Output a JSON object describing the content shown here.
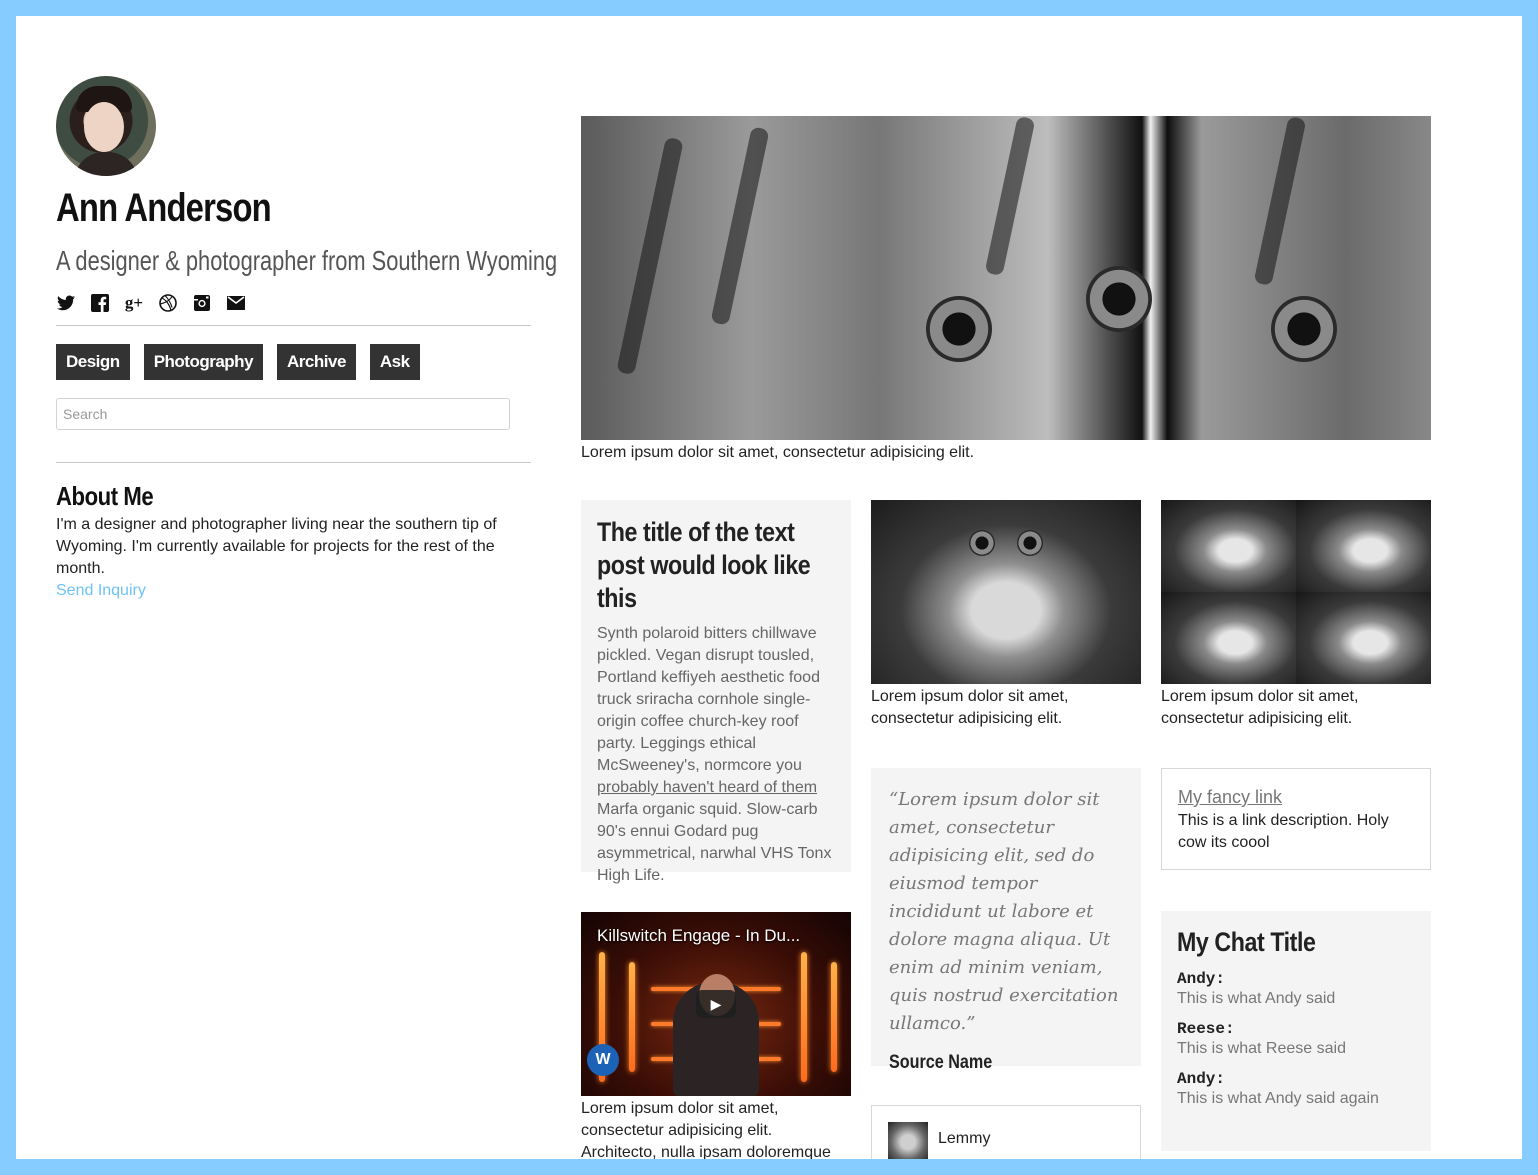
{
  "profile": {
    "name": "Ann Anderson",
    "tagline": "A designer & photographer from Southern Wyoming"
  },
  "socials": [
    {
      "icon": "twitter-icon",
      "glyph": "🐦"
    },
    {
      "icon": "facebook-icon",
      "glyph": "f"
    },
    {
      "icon": "google-plus-icon",
      "glyph": "g+"
    },
    {
      "icon": "dribbble-icon",
      "glyph": "◎"
    },
    {
      "icon": "instagram-icon",
      "glyph": "◙"
    },
    {
      "icon": "mail-icon",
      "glyph": "✉"
    }
  ],
  "nav": {
    "design": "Design",
    "photography": "Photography",
    "archive": "Archive",
    "ask": "Ask"
  },
  "search": {
    "placeholder": "Search"
  },
  "about": {
    "title": "About Me",
    "text": "I'm a designer and photographer living near the southern tip of Wyoming. I'm currently available for projects for the rest of the month.",
    "link": "Send Inquiry"
  },
  "hero": {
    "caption": "Lorem ipsum dolor sit amet, consectetur adipisicing elit."
  },
  "text_post": {
    "title": "The title of the text post would look like this",
    "body_before": "Synth polaroid bitters chillwave pickled. Vegan disrupt tousled, Portland keffiyeh aesthetic food truck sriracha cornhole single-origin coffee church-key roof party. Leggings ethical McSweeney's, normcore you ",
    "link": "probably haven't heard of them",
    "body_after": " Marfa organic squid. Slow-carb 90's ennui Godard pug asymmetrical, narwhal VHS Tonx High Life."
  },
  "photo_post_1": {
    "caption": "Lorem ipsum dolor sit amet, consectetur adipisicing elit."
  },
  "photo_post_2": {
    "caption": "Lorem ipsum dolor sit amet, consectetur adipisicing elit."
  },
  "quote_post": {
    "text": "“Lorem ipsum dolor sit amet, consectetur adipisicing elit, sed do eiusmod tempor incididunt ut labore et dolore magna aliqua. Ut enim ad minim veniam, quis nostrud exercitation ullamco.”",
    "source": "Source Name"
  },
  "link_post": {
    "title": "My fancy link",
    "description": "This is a link description. Holy cow its coool"
  },
  "video_post": {
    "video_title": "Killswitch Engage - In Du...",
    "caption": "Lorem ipsum dolor sit amet, consectetur adipisicing elit. Architecto, nulla ipsam doloremque deleniti ab"
  },
  "chat_post": {
    "title": "My Chat Title",
    "lines": [
      {
        "name": "Andy:",
        "text": "This is what Andy said"
      },
      {
        "name": "Reese:",
        "text": "This is what Reese said"
      },
      {
        "name": "Andy:",
        "text": "This is what Andy said again"
      }
    ]
  },
  "audio_post": {
    "artist": "Lemmy"
  },
  "colors": {
    "page_border": "#86ccff",
    "accent_link": "#6ec3f5",
    "nav_button": "#333333",
    "card_bg": "#f4f4f4"
  }
}
